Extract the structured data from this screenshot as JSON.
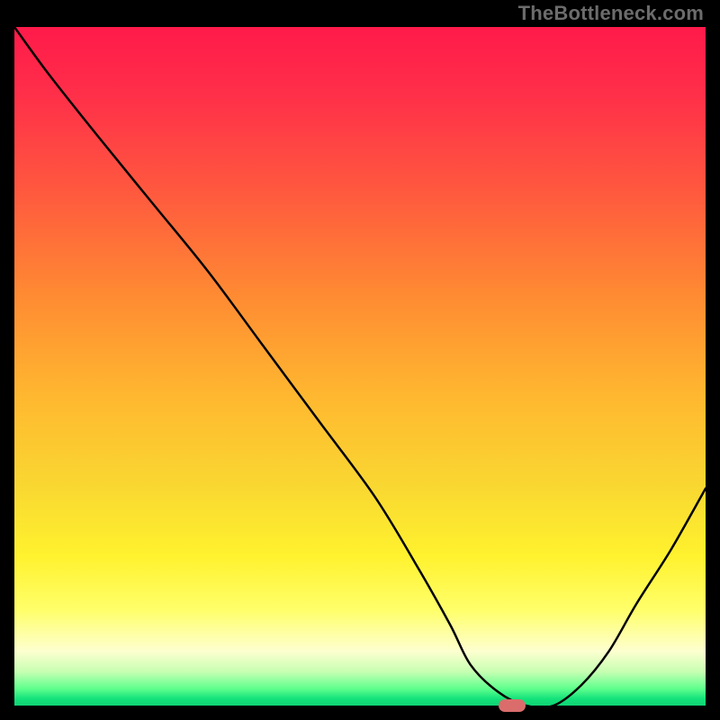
{
  "watermark": "TheBottleneck.com",
  "chart_data": {
    "type": "line",
    "title": "",
    "xlabel": "",
    "ylabel": "",
    "xlim": [
      0,
      100
    ],
    "ylim": [
      0,
      100
    ],
    "grid": false,
    "legend": null,
    "background_gradient": {
      "direction": "vertical",
      "stops": [
        {
          "pos": 0.0,
          "color": "#ff1a4a"
        },
        {
          "pos": 0.1,
          "color": "#ff2f49"
        },
        {
          "pos": 0.25,
          "color": "#ff5b3e"
        },
        {
          "pos": 0.4,
          "color": "#ff8c32"
        },
        {
          "pos": 0.55,
          "color": "#ffb930"
        },
        {
          "pos": 0.68,
          "color": "#f9d831"
        },
        {
          "pos": 0.78,
          "color": "#fff22e"
        },
        {
          "pos": 0.86,
          "color": "#ffff6b"
        },
        {
          "pos": 0.92,
          "color": "#fdffd0"
        },
        {
          "pos": 0.95,
          "color": "#c7ffb2"
        },
        {
          "pos": 0.975,
          "color": "#5fff8d"
        },
        {
          "pos": 0.99,
          "color": "#13e27a"
        },
        {
          "pos": 1.0,
          "color": "#0fd374"
        }
      ]
    },
    "series": [
      {
        "name": "bottleneck-curve",
        "color": "#000000",
        "x": [
          0,
          5,
          12,
          20,
          28,
          36,
          44,
          52,
          58,
          63,
          66,
          70,
          74,
          78,
          82,
          86,
          90,
          95,
          100
        ],
        "y": [
          100,
          93,
          84,
          74,
          64,
          53,
          42,
          31,
          21,
          12,
          6,
          2,
          0,
          0,
          3,
          8,
          15,
          23,
          32
        ]
      }
    ],
    "marker": {
      "name": "optimal-point-marker",
      "shape": "rounded-rect",
      "color": "#da6d6c",
      "x": 72,
      "y": 0
    }
  }
}
